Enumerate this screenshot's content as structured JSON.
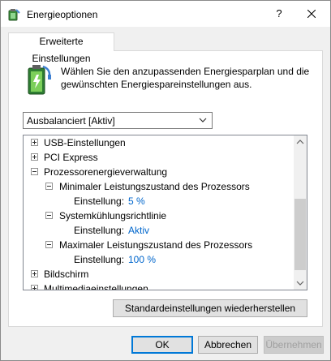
{
  "window": {
    "title": "Energieoptionen",
    "help_label": "?",
    "close_icon": "close-icon"
  },
  "tab": {
    "label": "Erweiterte Einstellungen"
  },
  "description": {
    "line1": "Wählen Sie den anzupassenden Energiesparplan und die",
    "line2": "gewünschten Energiespareinstellungen aus.",
    "icon": "battery-power-icon"
  },
  "plan_select": {
    "value": "Ausbalanciert [Aktiv]"
  },
  "tree": {
    "items": [
      {
        "label": "USB-Einstellungen",
        "expander": "plus"
      },
      {
        "label": "PCI Express",
        "expander": "plus"
      },
      {
        "label": "Prozessorenergieverwaltung",
        "expander": "minus"
      },
      {
        "label": "Minimaler Leistungszustand des Prozessors",
        "expander": "minus"
      },
      {
        "label": "Einstellung:",
        "value": "5 %"
      },
      {
        "label": "Systemkühlungsrichtlinie",
        "expander": "minus"
      },
      {
        "label": "Einstellung:",
        "value": "Aktiv"
      },
      {
        "label": "Maximaler Leistungszustand des Prozessors",
        "expander": "minus"
      },
      {
        "label": "Einstellung:",
        "value": "100 %"
      },
      {
        "label": "Bildschirm",
        "expander": "plus"
      },
      {
        "label": "Multimediaeinstellungen",
        "expander": "plus"
      }
    ]
  },
  "buttons": {
    "restore": "Standardeinstellungen wiederherstellen",
    "ok": "OK",
    "cancel": "Abbrechen",
    "apply": "Übernehmen"
  },
  "colors": {
    "value_text": "#0066cc",
    "accent": "#0078d7"
  }
}
